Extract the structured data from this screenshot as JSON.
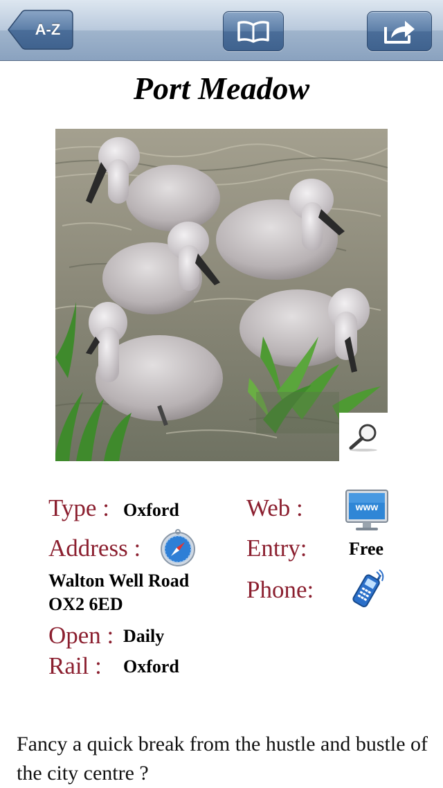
{
  "nav": {
    "back_label": "A-Z",
    "book_icon": "book-icon",
    "share_icon": "share-icon"
  },
  "title": "Port Meadow",
  "photo": {
    "zoom_icon": "magnifier-icon"
  },
  "info": {
    "type_label": "Type :",
    "type_value": "Oxford",
    "address_label": "Address :",
    "address_icon": "compass-icon",
    "address_line1": "Walton Well Road",
    "address_line2": "OX2 6ED",
    "open_label": "Open :",
    "open_value": "Daily",
    "rail_label": "Rail :",
    "rail_value": "Oxford",
    "web_label": "Web :",
    "web_icon": "www-icon",
    "web_icon_text": "www",
    "entry_label": "Entry:",
    "entry_value": "Free",
    "phone_label": "Phone:",
    "phone_icon": "mobile-phone-icon"
  },
  "description": "Fancy a quick break from the hustle and bustle of the city centre ?",
  "colors": {
    "label": "#8b1f2f",
    "nav_button": "#4a6d99",
    "navbar": "#b9c9dc"
  }
}
